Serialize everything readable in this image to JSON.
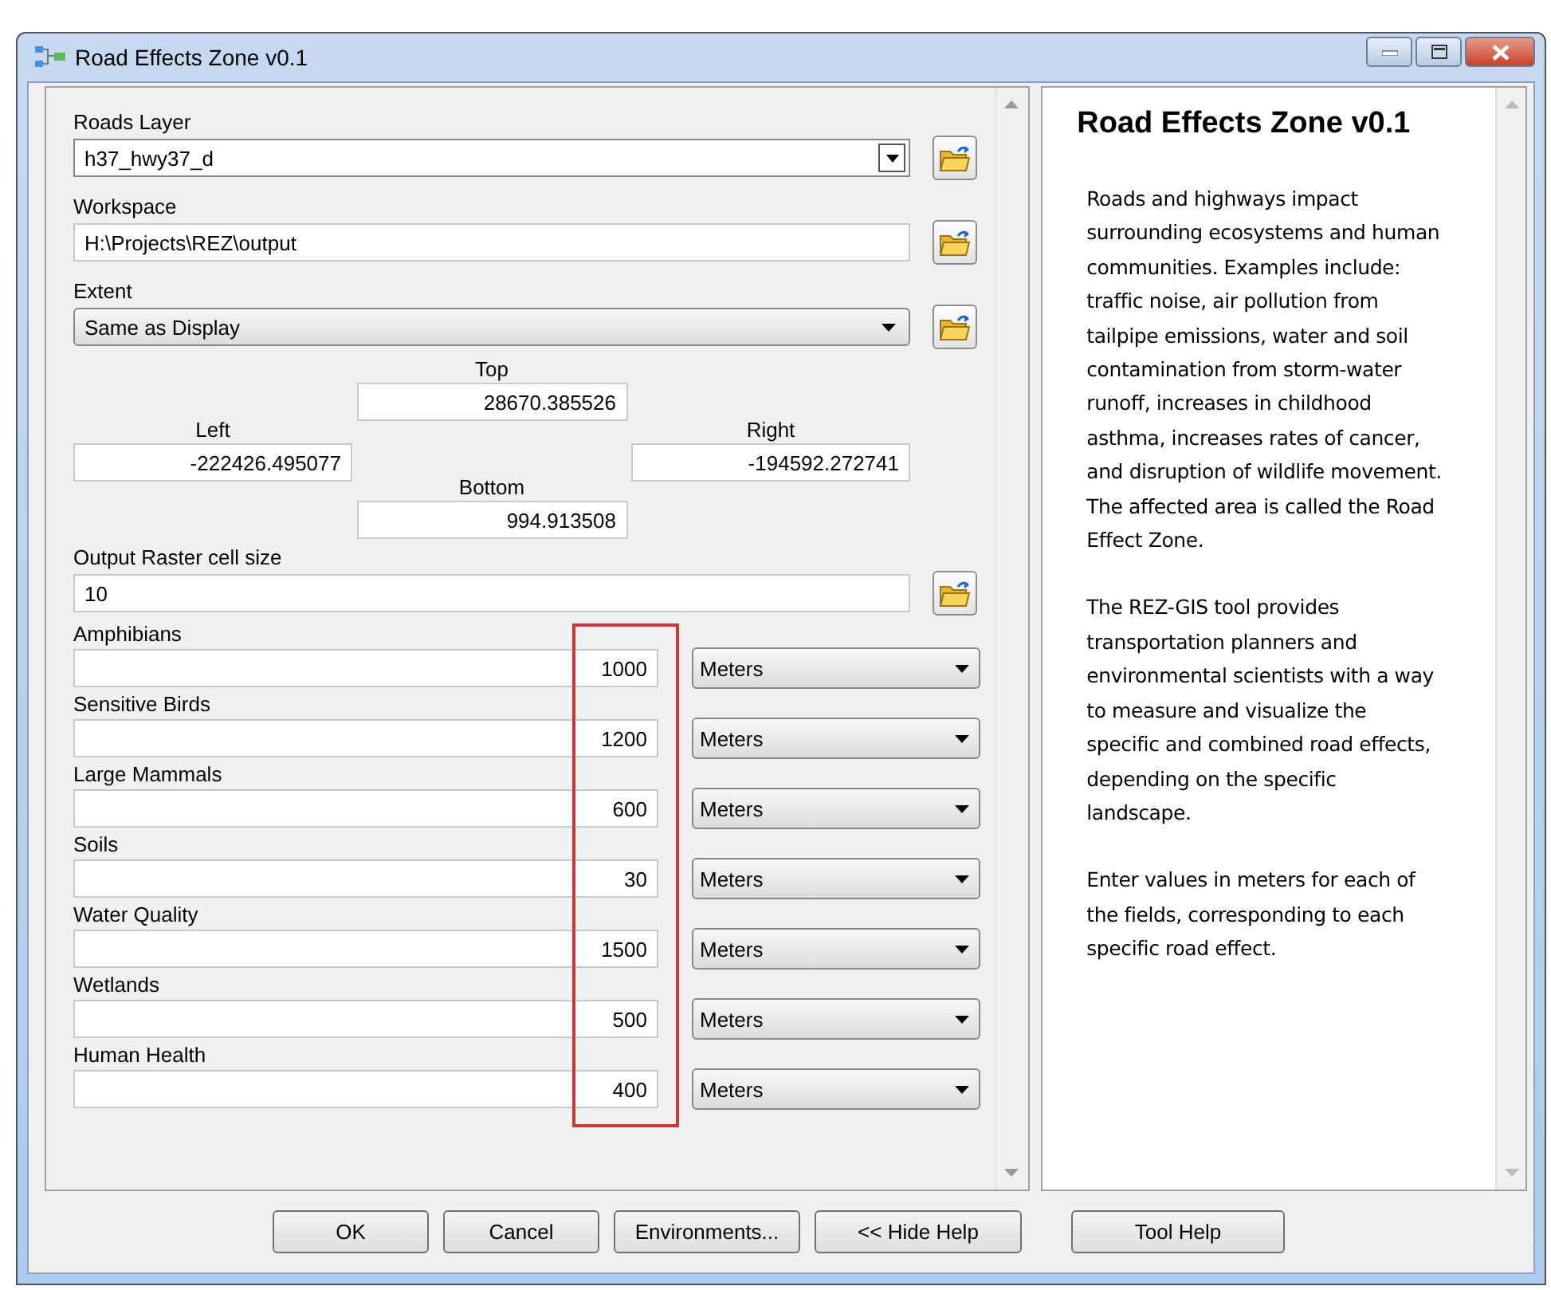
{
  "window": {
    "title": "Road Effects Zone v0.1"
  },
  "fields": [
    {
      "kind": "combo",
      "label": "Roads Layer",
      "value": "h37_hwy37_d"
    },
    {
      "kind": "text",
      "label": "Workspace",
      "value": "H:\\Projects\\REZ\\output"
    },
    {
      "kind": "dropdown",
      "label": "Extent",
      "value": "Same as Display"
    },
    {
      "kind": "text",
      "label": "Output Raster cell size",
      "value": "10"
    }
  ],
  "extent": {
    "top": {
      "label": "Top",
      "value": "28670.385526"
    },
    "left": {
      "label": "Left",
      "value": "-222426.495077"
    },
    "right": {
      "label": "Right",
      "value": "-194592.272741"
    },
    "bottom": {
      "label": "Bottom",
      "value": "994.913508"
    }
  },
  "distances": [
    {
      "label": "Amphibians",
      "value": "1000",
      "unit": "Meters"
    },
    {
      "label": "Sensitive Birds",
      "value": "1200",
      "unit": "Meters"
    },
    {
      "label": "Large Mammals",
      "value": "600",
      "unit": "Meters"
    },
    {
      "label": "Soils",
      "value": "30",
      "unit": "Meters"
    },
    {
      "label": "Water Quality",
      "value": "1500",
      "unit": "Meters"
    },
    {
      "label": "Wetlands",
      "value": "500",
      "unit": "Meters"
    },
    {
      "label": "Human Health",
      "value": "400",
      "unit": "Meters"
    }
  ],
  "help": {
    "title": "Road Effects Zone v0.1",
    "paragraphs": [
      "Roads and highways impact surrounding ecosystems and human communities. Examples include: traffic noise, air pollution from tailpipe emissions, water and soil contamination from storm-water runoff, increases in childhood asthma, increases rates of cancer, and disruption of wildlife movement. The affected area is called the Road Effect Zone.",
      "The REZ-GIS tool provides transportation planners and environmental scientists with a way to measure and visualize the specific and combined road effects, depending on the specific landscape.",
      "Enter values in meters for each of the fields, corresponding to each specific road effect."
    ]
  },
  "buttons": [
    "OK",
    "Cancel",
    "Environments...",
    "<< Hide Help",
    "Tool Help"
  ]
}
